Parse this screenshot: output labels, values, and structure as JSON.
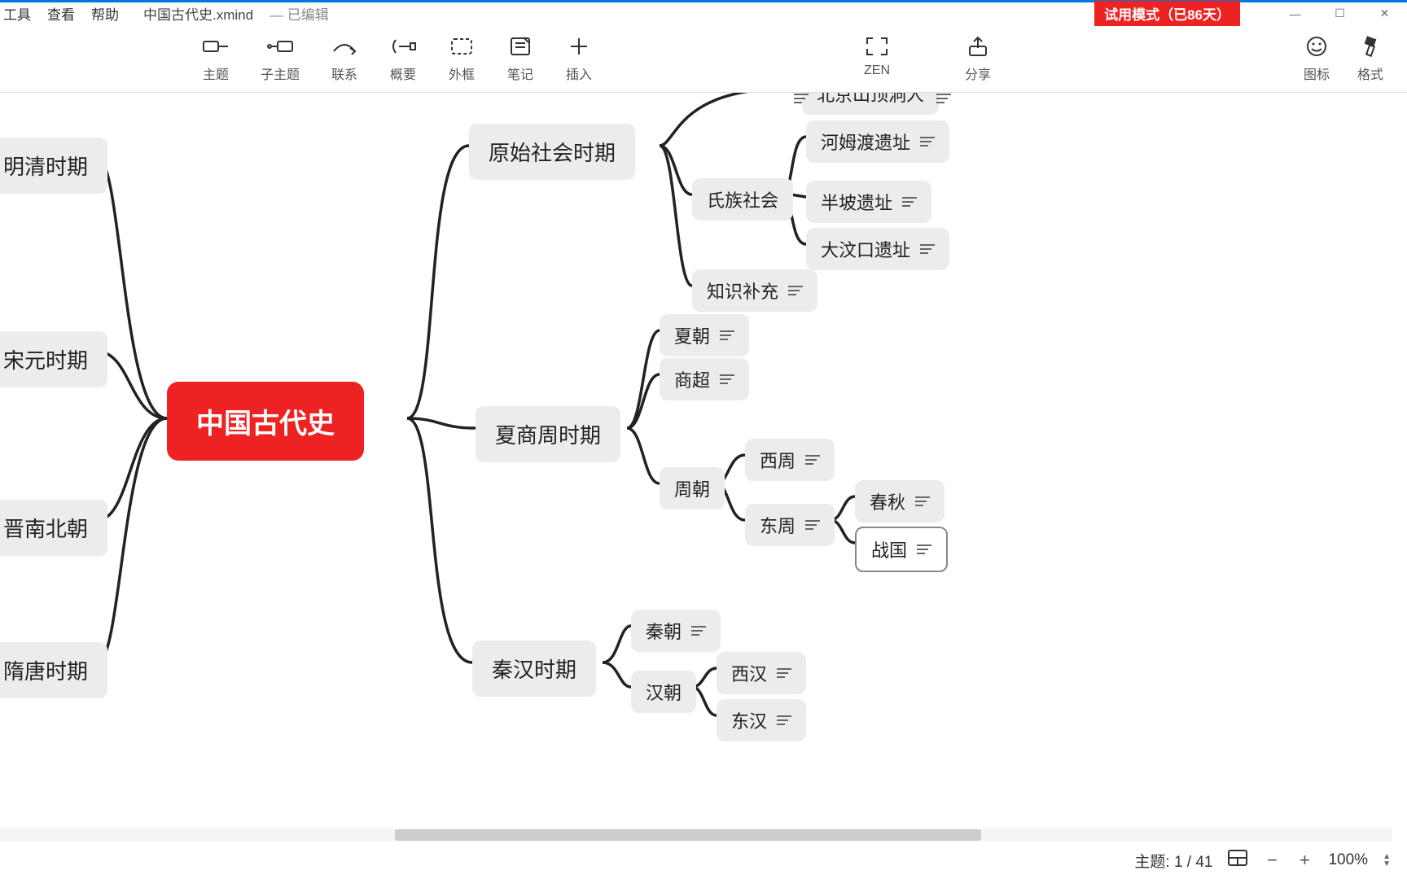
{
  "menu": {
    "tools": "工具",
    "view": "查看",
    "help": "帮助"
  },
  "file": {
    "name": "中国古代史.xmind",
    "status": "— 已编辑"
  },
  "trial_badge": "试用模式（已86天）",
  "toolbar": {
    "topic": "主题",
    "subtopic": "子主题",
    "relation": "联系",
    "summary": "概要",
    "boundary": "外框",
    "note": "笔记",
    "insert": "插入",
    "zen": "ZEN",
    "share": "分享",
    "icon_panel": "图标",
    "format": "格式"
  },
  "nodes": {
    "central": "中国古代史",
    "mingqing": "明清时期",
    "songyuan": "宋元时期",
    "jinnanbei": "晋南北朝",
    "suitang": "隋唐时期",
    "primitive": "原始社会时期",
    "clan": "氏族社会",
    "beijing": "北京山顶洞人",
    "hemudu": "河姆渡遗址",
    "banpo": "半坡遗址",
    "dawenkou": "大汶口遗址",
    "knowledge": "知识补充",
    "xiashangzhou": "夏商周时期",
    "xia": "夏朝",
    "shang": "商超",
    "zhou": "周朝",
    "xizhou": "西周",
    "dongzhou": "东周",
    "chunqiu": "春秋",
    "zhanguo": "战国",
    "qinhan": "秦汉时期",
    "qin": "秦朝",
    "han": "汉朝",
    "xihan": "西汉",
    "donghan": "东汉"
  },
  "statusbar": {
    "topic_label": "主题:",
    "topic_count": "1 / 41",
    "zoom": "100%"
  }
}
